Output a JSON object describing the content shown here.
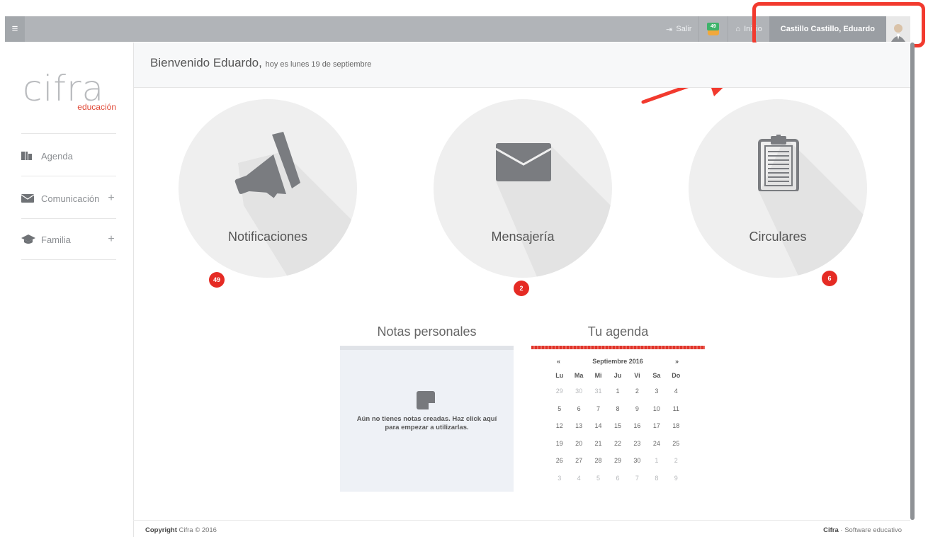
{
  "topbar": {
    "menu_icon": "hamburger-icon",
    "logout_label": "Salir",
    "notification_count": "49",
    "home_label": "Inicio",
    "user_name": "Castillo Castillo, Eduardo"
  },
  "sidebar": {
    "logo_word": "cifra",
    "logo_sub": "educación",
    "items": [
      {
        "label": "Agenda",
        "icon": "book-icon",
        "expandable": false
      },
      {
        "label": "Comunicación",
        "icon": "envelope-icon",
        "expandable": true
      },
      {
        "label": "Familia",
        "icon": "graduation-cap-icon",
        "expandable": true
      }
    ]
  },
  "welcome": {
    "greeting": "Bienvenido Eduardo,",
    "date_text": "hoy es lunes 19 de septiembre"
  },
  "tiles": [
    {
      "label": "Notificaciones",
      "badge": "49",
      "icon": "megaphone-icon"
    },
    {
      "label": "Mensajería",
      "badge": "2",
      "icon": "envelope-icon"
    },
    {
      "label": "Circulares",
      "badge": "6",
      "icon": "clipboard-icon"
    }
  ],
  "notes": {
    "title": "Notas personales",
    "empty_text": "Aún no tienes notas creadas. Haz click aquí para empezar a utilizarlas."
  },
  "agenda": {
    "title": "Tu agenda",
    "prev": "«",
    "next": "»",
    "month": "Septiembre 2016",
    "weekdays": [
      "Lu",
      "Ma",
      "Mi",
      "Ju",
      "Vi",
      "Sa",
      "Do"
    ],
    "weeks": [
      [
        "29",
        "30",
        "31",
        "1",
        "2",
        "3",
        "4"
      ],
      [
        "5",
        "6",
        "7",
        "8",
        "9",
        "10",
        "11"
      ],
      [
        "12",
        "13",
        "14",
        "15",
        "16",
        "17",
        "18"
      ],
      [
        "19",
        "20",
        "21",
        "22",
        "23",
        "24",
        "25"
      ],
      [
        "26",
        "27",
        "28",
        "29",
        "30",
        "1",
        "2"
      ],
      [
        "3",
        "4",
        "5",
        "6",
        "7",
        "8",
        "9"
      ]
    ]
  },
  "footer": {
    "copyright_bold": "Copyright",
    "copyright_rest": "Cifra © 2016",
    "brand_bold": "Cifra",
    "brand_rest": "· Software educativo"
  },
  "colors": {
    "accent_red": "#e52b24",
    "topbar_gray": "#b1b4b8",
    "highlight_red": "#f23a2e"
  }
}
